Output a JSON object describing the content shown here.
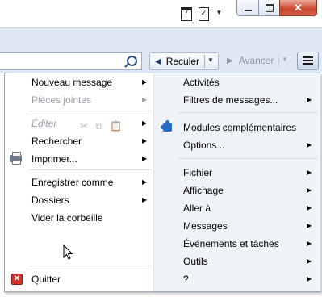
{
  "titlebar": {
    "calendar_icon_day": "7",
    "task_icon_mark": "✓",
    "dropdown_glyph": "▾",
    "close_glyph": "✕"
  },
  "toolbar": {
    "search_placeholder": "",
    "back_label": "Reculer",
    "forward_label": "Avancer",
    "back_glyph": "◀",
    "forward_glyph": "▶",
    "dropdown_glyph": "▼"
  },
  "menu": {
    "left": {
      "new_message": "Nouveau message",
      "attachments": "Pièces jointes",
      "edit": "Éditer",
      "edit_tools": [
        "✂",
        "⧉",
        "📋"
      ],
      "find": "Rechercher",
      "print": "Imprimer...",
      "save_as": "Enregistrer comme",
      "folders": "Dossiers",
      "empty_trash": "Vider la corbeille",
      "quit": "Quitter"
    },
    "right": {
      "activities": "Activités",
      "message_filters": "Filtres de messages...",
      "addons": "Modules complémentaires",
      "options": "Options...",
      "file": "Fichier",
      "view": "Affichage",
      "go": "Aller à",
      "messages": "Messages",
      "events_tasks": "Événements et tâches",
      "tools": "Outils",
      "help": "?"
    },
    "chevron": "▶"
  },
  "colors": {
    "toolbar_bg": "#dfe9f5",
    "menu_right_bg": "#eff3f8",
    "disabled_text": "#9aa0a8",
    "close_button": "#c9472d"
  }
}
